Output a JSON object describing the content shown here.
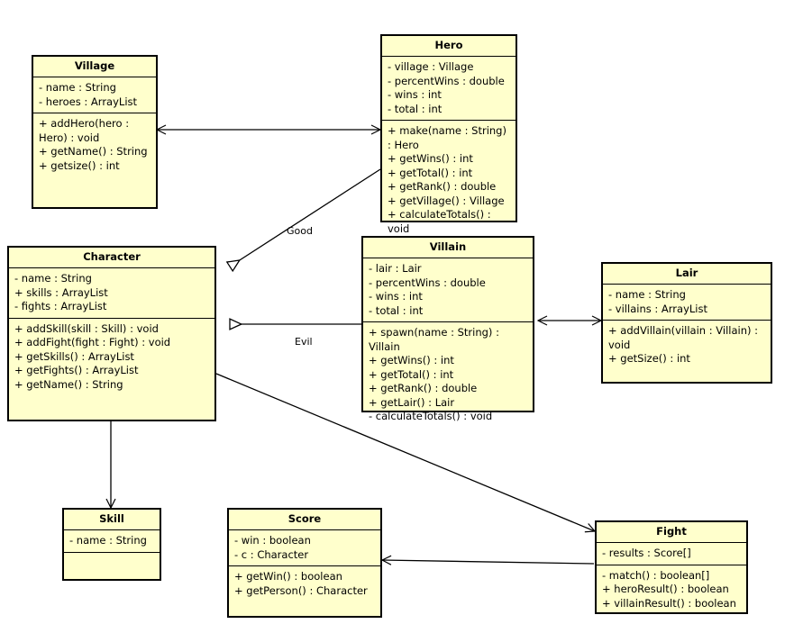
{
  "diagram": {
    "title": "UML Class Diagram",
    "background_color": "#ffffff",
    "class_fill_color": "#ffffcc",
    "class_border_color": "#000000",
    "edge_color": "#000000"
  },
  "classes": [
    {
      "id": "village",
      "name": "Village",
      "attributes": [
        "- name : String",
        "- heroes : ArrayList"
      ],
      "operations": [
        "+ addHero(hero : Hero) : void",
        "+ getName() : String",
        "+ getsize() : int"
      ]
    },
    {
      "id": "hero",
      "name": "Hero",
      "attributes": [
        "- village : Village",
        "- percentWins : double",
        "- wins : int",
        "- total : int"
      ],
      "operations": [
        "+ make(name : String) : Hero",
        "+ getWins() : int",
        "+ getTotal() : int",
        "+ getRank() : double",
        "+ getVillage() : Village",
        "+ calculateTotals() : void"
      ]
    },
    {
      "id": "character",
      "name": "Character",
      "attributes": [
        "- name : String",
        "+ skills : ArrayList",
        "- fights : ArrayList"
      ],
      "operations": [
        "+ addSkill(skill : Skill) : void",
        "+ addFight(fight : Fight) : void",
        "+ getSkills() : ArrayList",
        "+ getFights() : ArrayList",
        "+ getName() : String"
      ]
    },
    {
      "id": "villain",
      "name": "Villain",
      "attributes": [
        "- lair : Lair",
        "- percentWins : double",
        "- wins : int",
        "- total : int"
      ],
      "operations": [
        "+ spawn(name : String) : Villain",
        "+ getWins() : int",
        "+ getTotal() : int",
        "+ getRank() : double",
        "+ getLair() : Lair",
        "- calculateTotals() : void"
      ]
    },
    {
      "id": "lair",
      "name": "Lair",
      "attributes": [
        "- name : String",
        "- villains : ArrayList"
      ],
      "operations": [
        "+ addVillain(villain : Villain) : void",
        "+ getSize() : int"
      ]
    },
    {
      "id": "skill",
      "name": "Skill",
      "attributes": [
        "- name : String"
      ],
      "operations": []
    },
    {
      "id": "score",
      "name": "Score",
      "attributes": [
        "- win : boolean",
        "- c : Character"
      ],
      "operations": [
        "+ getWin() : boolean",
        "+ getPerson() : Character"
      ]
    },
    {
      "id": "fight",
      "name": "Fight",
      "attributes": [
        "- results : Score[]"
      ],
      "operations": [
        "- match() : boolean[]",
        "+ heroResult() : boolean",
        "+ villainResult() : boolean"
      ]
    }
  ],
  "relationships": [
    {
      "id": "village-hero",
      "from": "Village",
      "to": "Hero",
      "label": "",
      "kind": "association-bidirectional"
    },
    {
      "id": "hero-character",
      "from": "Hero",
      "to": "Character",
      "label": "Good",
      "kind": "generalization"
    },
    {
      "id": "villain-character",
      "from": "Villain",
      "to": "Character",
      "label": "Evil",
      "kind": "generalization"
    },
    {
      "id": "villain-lair",
      "from": "Villain",
      "to": "Lair",
      "label": "",
      "kind": "association-bidirectional"
    },
    {
      "id": "character-skill",
      "from": "Character",
      "to": "Skill",
      "label": "",
      "kind": "association-directed"
    },
    {
      "id": "character-fight",
      "from": "Character",
      "to": "Fight",
      "label": "",
      "kind": "association-directed"
    },
    {
      "id": "fight-score",
      "from": "Fight",
      "to": "Score",
      "label": "",
      "kind": "association-directed"
    }
  ],
  "edge_labels": {
    "good": "Good",
    "evil": "Evil"
  }
}
